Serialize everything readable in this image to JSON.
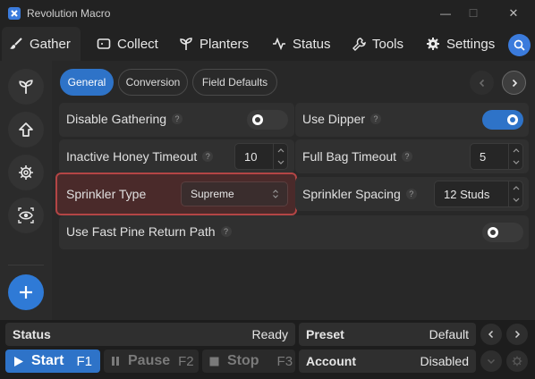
{
  "window": {
    "title": "Revolution Macro",
    "minimize_glyph": "—",
    "maximize_glyph": "☐",
    "close_glyph": "✕"
  },
  "tabs": [
    {
      "label": "Gather",
      "icon": "paintbrush-icon",
      "active": true
    },
    {
      "label": "Collect",
      "icon": "ticket-icon"
    },
    {
      "label": "Planters",
      "icon": "sprout-icon"
    },
    {
      "label": "Status",
      "icon": "pulse-icon"
    },
    {
      "label": "Tools",
      "icon": "wrench-icon"
    },
    {
      "label": "Settings",
      "icon": "gear-icon"
    }
  ],
  "sidebar": {
    "items": [
      "sprout-icon",
      "upload-arrow-icon",
      "gear-icon",
      "eye-icon"
    ],
    "add_icon": "plus-icon"
  },
  "subtabs": [
    {
      "label": "General",
      "active": true
    },
    {
      "label": "Conversion"
    },
    {
      "label": "Field Defaults"
    }
  ],
  "settings": {
    "disable_gathering": {
      "label": "Disable Gathering",
      "help": "?",
      "on": false
    },
    "use_dipper": {
      "label": "Use Dipper",
      "help": "?",
      "on": true
    },
    "inactive_honey_timeout": {
      "label": "Inactive Honey Timeout",
      "help": "?",
      "value": "10"
    },
    "full_bag_timeout": {
      "label": "Full Bag Timeout",
      "help": "?",
      "value": "5"
    },
    "sprinkler_type": {
      "label": "Sprinkler Type",
      "value": "Supreme"
    },
    "sprinkler_spacing": {
      "label": "Sprinkler Spacing",
      "help": "?",
      "value": "12 Studs"
    },
    "fast_pine_return": {
      "label": "Use Fast Pine Return Path",
      "help": "?",
      "on": false
    }
  },
  "footer": {
    "status_label": "Status",
    "status_value": "Ready",
    "preset_label": "Preset",
    "preset_value": "Default",
    "account_label": "Account",
    "account_value": "Disabled",
    "start": {
      "label": "Start",
      "key": "F1"
    },
    "pause": {
      "label": "Pause",
      "key": "F2"
    },
    "stop": {
      "label": "Stop",
      "key": "F3"
    }
  },
  "colors": {
    "accent": "#2e73c8",
    "highlight_border": "#b34545"
  }
}
